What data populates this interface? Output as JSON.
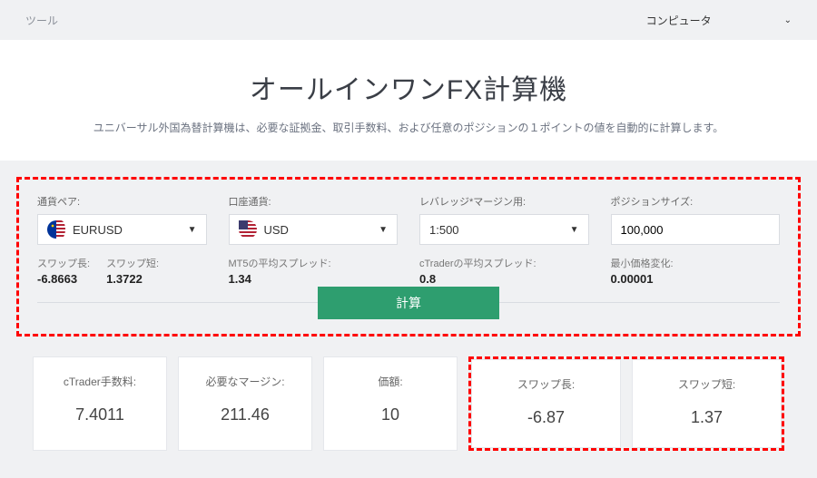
{
  "topbar": {
    "left": "ツール",
    "right": "コンピュータ"
  },
  "hero": {
    "title": "オールインワンFX計算機",
    "subtitle": "ユニバーサル外国為替計算機は、必要な証拠金、取引手数料、および任意のポジションの１ポイントの値を自動的に計算します。"
  },
  "form": {
    "pair": {
      "label": "通貨ペア:",
      "value": "EURUSD"
    },
    "account": {
      "label": "口座通貨:",
      "value": "USD"
    },
    "leverage": {
      "label": "レバレッジ*マージン用:",
      "value": "1:500"
    },
    "size": {
      "label": "ポジションサイズ:",
      "value": "100,000"
    },
    "swap_long_label": "スワップ長:",
    "swap_long_value": "-6.8663",
    "swap_short_label": "スワップ短:",
    "swap_short_value": "1.3722",
    "mt5_spread_label": "MT5の平均スプレッド:",
    "mt5_spread_value": "1.34",
    "ctrader_spread_label": "cTraderの平均スプレッド:",
    "ctrader_spread_value": "0.8",
    "min_change_label": "最小価格変化:",
    "min_change_value": "0.00001",
    "calc_button": "計算"
  },
  "results": {
    "commission": {
      "label": "cTrader手数料:",
      "value": "7.4011"
    },
    "margin": {
      "label": "必要なマージン:",
      "value": "211.46"
    },
    "price": {
      "label": "価額:",
      "value": "10"
    },
    "swap_long": {
      "label": "スワップ長:",
      "value": "-6.87"
    },
    "swap_short": {
      "label": "スワップ短:",
      "value": "1.37"
    }
  }
}
